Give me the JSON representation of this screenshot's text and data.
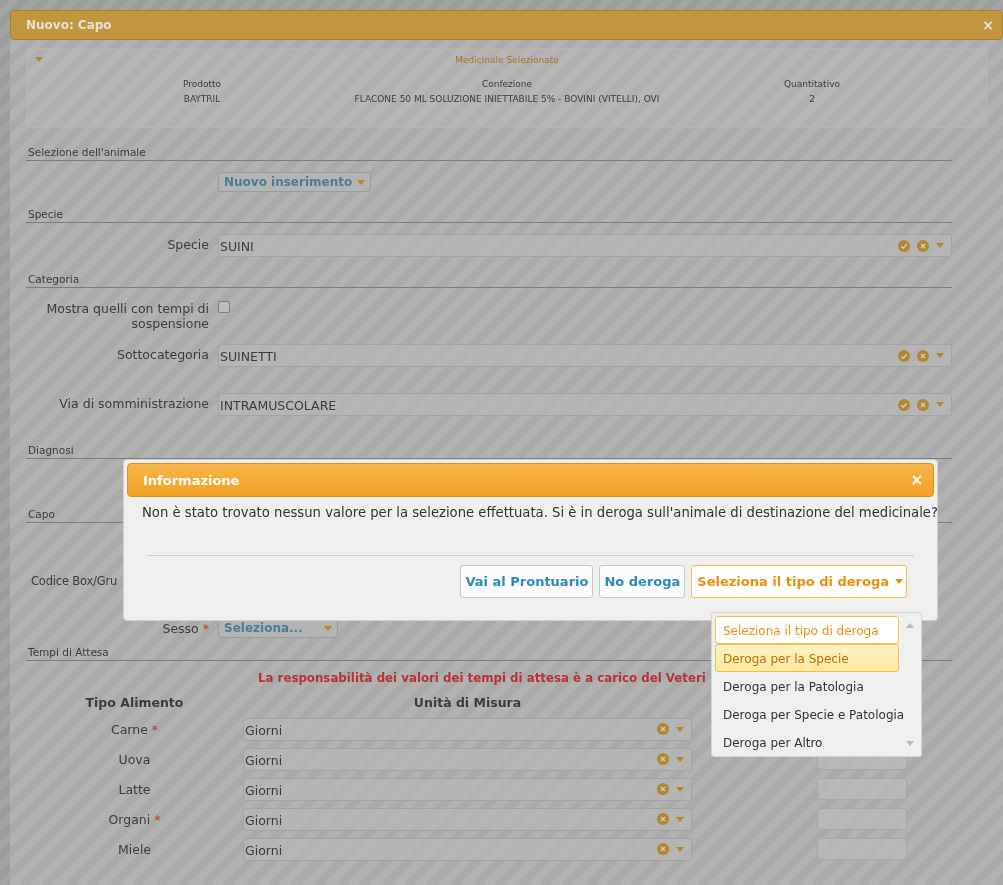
{
  "modal": {
    "title": "Nuovo: Capo",
    "close": "×"
  },
  "medicinal_panel": {
    "title": "Medicinale Selezionato",
    "expanded": true,
    "columns": [
      {
        "heading": "Prodotto",
        "value": "BAYTRIL"
      },
      {
        "heading": "Confezione",
        "value": "FLACONE 50 ML SOLUZIONE INIETTABILE 5% - BOVINI (VITELLI), OVI"
      },
      {
        "heading": "Quantitativo",
        "value": "2"
      }
    ]
  },
  "form": [
    {
      "kind": "section",
      "title": "Selezione dell'animale"
    },
    {
      "kind": "menu_button",
      "label": "Nuovo inserimento"
    },
    {
      "kind": "section",
      "title": "Specie"
    },
    {
      "kind": "select",
      "label": "Specie",
      "value": "SUINI"
    },
    {
      "kind": "section",
      "title": "Categoria"
    },
    {
      "kind": "checkbox",
      "label": "Mostra quelli con tempi di sospensione",
      "checked": false
    },
    {
      "kind": "select",
      "label": "Sottocategoria",
      "value": "SUINETTI"
    },
    {
      "kind": "select",
      "label": "Via di somministrazione",
      "value": "INTRAMUSCOLARE"
    },
    {
      "kind": "section",
      "title": "Diagnosi"
    },
    {
      "kind": "section",
      "title": "Capo"
    },
    {
      "kind": "label",
      "label": "Codice Box/Gru"
    },
    {
      "kind": "small_select",
      "label": "Sesso",
      "mark": "*",
      "value": "Seleziona..."
    },
    {
      "kind": "section",
      "title": "Tempi di Attesa"
    },
    {
      "kind": "warning",
      "text": "La responsabilità dei valori dei tempi di attesa è a carico del Veteri"
    }
  ],
  "waiting_table": {
    "columns": [
      "Tipo Alimento",
      "Unità di Misura"
    ],
    "rows": [
      {
        "food": "Carne",
        "mark": "*",
        "unit": "Giorni"
      },
      {
        "food": "Uova",
        "unit": "Giorni"
      },
      {
        "food": "Latte",
        "unit": "Giorni"
      },
      {
        "food": "Organi",
        "mark": "*",
        "unit": "Giorni"
      },
      {
        "food": "Miele",
        "unit": "Giorni"
      }
    ]
  },
  "info_dialog": {
    "title": "Informazione",
    "close": "×",
    "message": "Non è stato trovato nessun valore per la selezione effettuata. Si è in deroga sull'animale di destinazione del medicinale?",
    "buttons": [
      "Vai al Prontuario",
      "No deroga"
    ],
    "dropdown": {
      "value": "Seleziona il tipo di deroga",
      "open": true,
      "options": [
        {
          "label": "Seleziona il tipo di deroga",
          "selected": true,
          "highlighted": false
        },
        {
          "label": "Deroga per la Specie",
          "selected": false,
          "highlighted": true
        },
        {
          "label": "Deroga per la Patologia",
          "selected": false,
          "highlighted": false
        },
        {
          "label": "Deroga per Specie e Patologia",
          "selected": false,
          "highlighted": false
        },
        {
          "label": "Deroga per Altro",
          "selected": false,
          "highlighted": false
        }
      ]
    }
  }
}
